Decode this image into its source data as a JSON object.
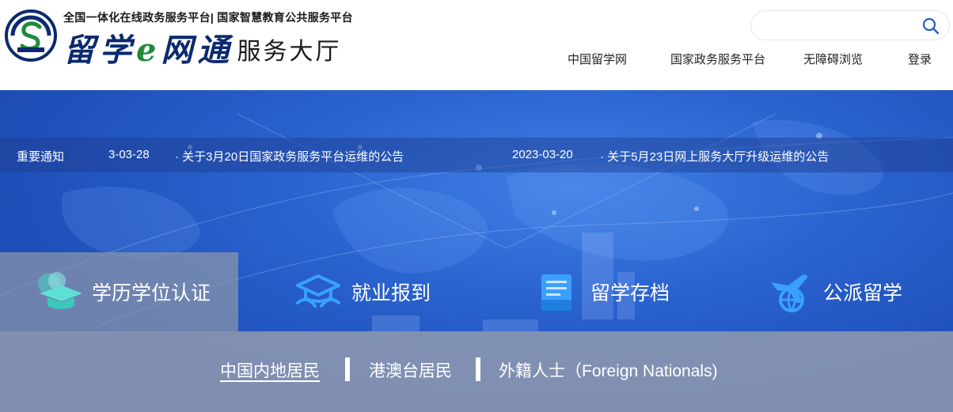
{
  "header": {
    "tagline": "全国一体化在线政务服务平台| 国家智慧教育公共服务平台",
    "brand_main_1": "留学",
    "brand_e": "e",
    "brand_main_2": "网通",
    "brand_sub": "服务大厅",
    "search": {
      "placeholder": "",
      "value": ""
    }
  },
  "topnav": [
    "中国留学网",
    "国家政务服务平台",
    "无障碍浏览",
    "登录"
  ],
  "notice": {
    "title": "重要通知",
    "items": [
      {
        "date": "3-03-28",
        "text": "· 关于3月20日国家政务服务平台运维的公告"
      },
      {
        "date": "2023-03-20",
        "text": "· 关于5月23日网上服务大厅升级运维的公告"
      }
    ]
  },
  "categories": [
    {
      "label": "学历学位认证",
      "icon": "graduation-cap-icon",
      "active": true
    },
    {
      "label": "就业报到",
      "icon": "cap-hands-icon",
      "active": false
    },
    {
      "label": "留学存档",
      "icon": "document-folder-icon",
      "active": false
    },
    {
      "label": "公派留学",
      "icon": "airplane-globe-icon",
      "active": false
    }
  ],
  "subtabs": [
    {
      "label": "中国内地居民",
      "active": true
    },
    {
      "label": "港澳台居民",
      "active": false
    },
    {
      "label": "外籍人士（Foreign Nationals)",
      "active": false
    }
  ],
  "colors": {
    "brand_blue": "#0b2a6e",
    "banner_blue": "#2a63cf",
    "icon_teal": "#4fd4c9",
    "icon_blue": "#3aa0ff"
  }
}
